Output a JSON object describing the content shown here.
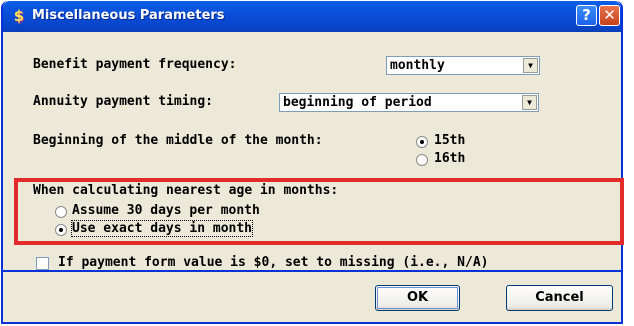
{
  "window": {
    "title": "Miscellaneous Parameters",
    "help_glyph": "?",
    "close_glyph": "✕"
  },
  "benefit_frequency": {
    "label": "Benefit payment frequency:",
    "value": "monthly"
  },
  "annuity_timing": {
    "label": "Annuity payment timing:",
    "value": "beginning of period"
  },
  "middle_of_month": {
    "label": "Beginning of the middle of the month:",
    "options": [
      "15th",
      "16th"
    ],
    "selected": "15th"
  },
  "nearest_age": {
    "label": "When calculating nearest age in months:",
    "options": [
      "Assume 30 days per month",
      "Use exact days in month"
    ],
    "selected": "Use exact days in month"
  },
  "missing_checkbox": {
    "label": "If payment form value is $0, set to missing (i.e., N/A)",
    "checked": false
  },
  "buttons": {
    "ok": "OK",
    "cancel": "Cancel"
  },
  "colors": {
    "title_bar": "#0b4fd9",
    "highlight_box": "#e32b2b",
    "dialog_bg": "#ece9d8"
  }
}
